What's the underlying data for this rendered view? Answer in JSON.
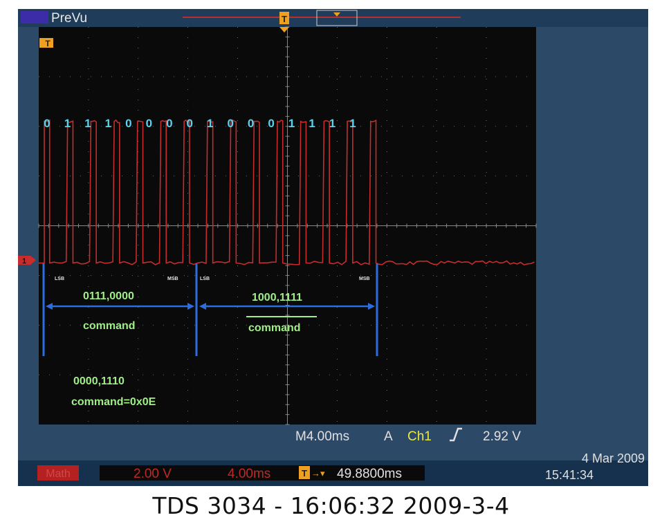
{
  "header": {
    "mode": "PreVu"
  },
  "trigger_marker": "T",
  "channel_marker": "1",
  "bit_labels": [
    "0",
    "1",
    "1",
    "1",
    "0",
    "0",
    "0",
    "0",
    "1",
    "0",
    "0",
    "0",
    "1",
    "1",
    "1",
    "1"
  ],
  "annotations": {
    "lsb_1": "LSB",
    "msb_1": "MSB",
    "lsb_2": "LSB",
    "msb_2": "MSB",
    "byte1_value": "0111,0000",
    "byte1_label": "command",
    "byte2_value": "1000,1111",
    "byte2_label": "command",
    "result_value": "0000,1110",
    "result_label": "command=0x0E"
  },
  "readout": {
    "timebase": "M4.00ms",
    "acq": "A",
    "source": "Ch1",
    "slope_icon": "rising-edge-icon",
    "level": "2.92 V"
  },
  "bottom": {
    "math_label": "Math",
    "volts": "2.00 V",
    "time": "4.00ms",
    "trigger_pos_icon": "T",
    "trigger_arrow": "→▾",
    "trigger_pos": "49.8800ms",
    "date": "4 Mar 2009",
    "time_of_day": "15:41:34"
  },
  "caption": "TDS 3034 - 16:06:32   2009-3-4",
  "colors": {
    "trace": "#c82c2c",
    "bits": "#58d4ee",
    "annotation": "#a0ee88",
    "arrow": "#2c6ee0",
    "readout": "#e0e0e0",
    "ch1": "#eaea40",
    "grid": "#888888"
  },
  "waveform": {
    "pulse_count": 15,
    "low_level_div": -0.75,
    "high_level_div": 2.1
  }
}
